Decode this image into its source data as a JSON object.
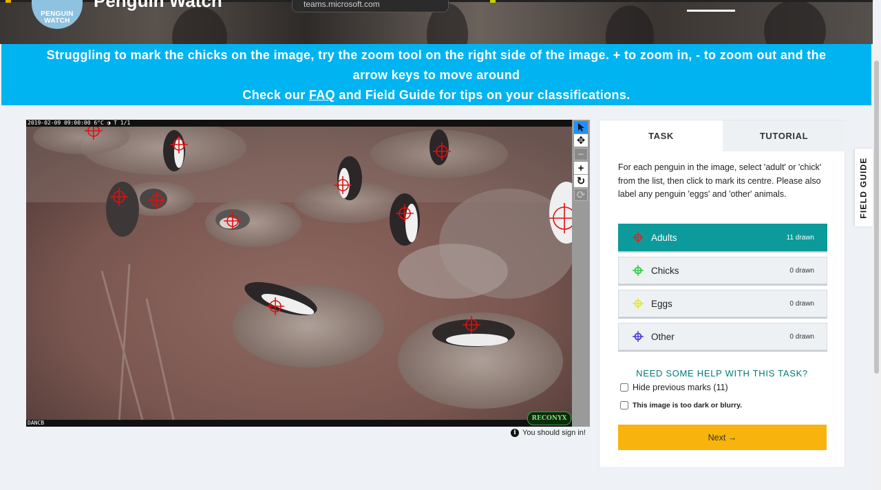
{
  "header": {
    "logo_line1": "PENGUIN",
    "logo_line2": "WATCH",
    "title": "Penguin Watch",
    "url": "teams.microsoft.com"
  },
  "banner": {
    "line1": "Struggling to mark the chicks on the image, try the zoom tool on the right side of the image. + to zoom in, - to zoom out and the",
    "line2": "arrow keys to move around",
    "line3_prefix": "Check our ",
    "faq_link": "FAQ",
    "line3_suffix": " and Field Guide for tips on your classifications."
  },
  "subject": {
    "cam_info": "2019-02-09 09:00:00    6°C ◑      T 1/1",
    "camera_id": "DANCB",
    "brand": "RECONYX"
  },
  "toolbar": {
    "icons": [
      "pointer-icon",
      "move-icon",
      "zoom-out-icon",
      "zoom-in-icon",
      "rotate-icon",
      "reset-icon"
    ]
  },
  "signin": "You should sign in!",
  "task_panel": {
    "tabs": [
      "TASK",
      "TUTORIAL"
    ],
    "instructions": "For each penguin in the image, select 'adult' or 'chick' from the list, then click to mark its centre. Please also label any penguin 'eggs' and 'other' animals.",
    "tools": [
      {
        "label": "Adults",
        "count": "11 drawn",
        "color": "#d22b2b"
      },
      {
        "label": "Chicks",
        "count": "0 drawn",
        "color": "#2ecc40"
      },
      {
        "label": "Eggs",
        "count": "0 drawn",
        "color": "#e5e53a"
      },
      {
        "label": "Other",
        "count": "0 drawn",
        "color": "#4a3fd6"
      }
    ],
    "help": "NEED SOME HELP WITH THIS TASK?",
    "hide_marks": "Hide previous marks (11)",
    "dark_blurry": "This image is too dark or blurry.",
    "next": "Next →"
  },
  "field_guide": "FIELD GUIDE",
  "colors": {
    "banner": "#00b4f2",
    "active_tool": "#0d9a9a",
    "next_button": "#f8b40c",
    "help_text": "#00787a",
    "marker": "#e01010"
  }
}
